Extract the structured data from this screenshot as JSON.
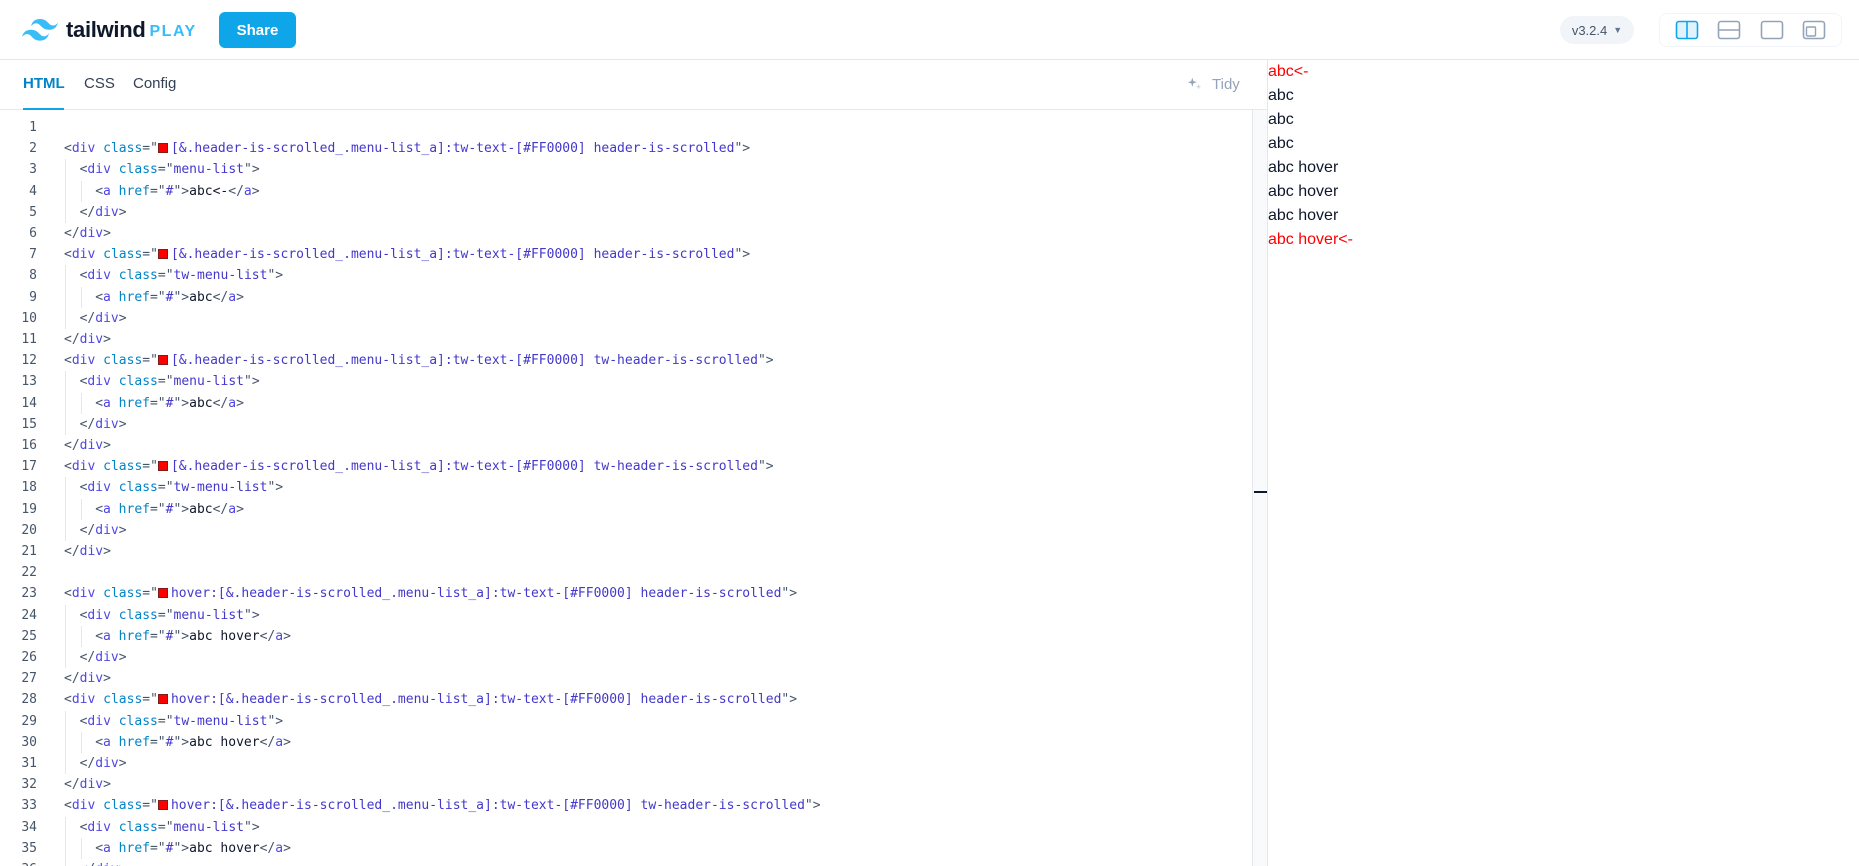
{
  "header": {
    "logo_word": "tailwind",
    "logo_play": "PLAY",
    "share_label": "Share",
    "version": "v3.2.4",
    "layout_buttons": [
      "split-vertical-icon",
      "split-horizontal-icon",
      "editor-only-icon",
      "preview-only-icon"
    ],
    "active_layout": "split-vertical-icon"
  },
  "tabs": {
    "items": [
      "HTML",
      "CSS",
      "Config"
    ],
    "active": "HTML",
    "tidy_label": "Tidy"
  },
  "editor": {
    "lines": [
      "",
      "<div class=\"[&.header-is-scrolled_.menu-list_a]:tw-text-[#FF0000] header-is-scrolled\">",
      "  <div class=\"menu-list\">",
      "    <a href=\"#\">abc<-</a>",
      "  </div>",
      "</div>",
      "<div class=\"[&.header-is-scrolled_.menu-list_a]:tw-text-[#FF0000] header-is-scrolled\">",
      "  <div class=\"tw-menu-list\">",
      "    <a href=\"#\">abc</a>",
      "  </div>",
      "</div>",
      "<div class=\"[&.header-is-scrolled_.menu-list_a]:tw-text-[#FF0000] tw-header-is-scrolled\">",
      "  <div class=\"menu-list\">",
      "    <a href=\"#\">abc</a>",
      "  </div>",
      "</div>",
      "<div class=\"[&.header-is-scrolled_.menu-list_a]:tw-text-[#FF0000] tw-header-is-scrolled\">",
      "  <div class=\"tw-menu-list\">",
      "    <a href=\"#\">abc</a>",
      "  </div>",
      "</div>",
      "",
      "<div class=\"hover:[&.header-is-scrolled_.menu-list_a]:tw-text-[#FF0000] header-is-scrolled\">",
      "  <div class=\"menu-list\">",
      "    <a href=\"#\">abc hover</a>",
      "  </div>",
      "</div>",
      "<div class=\"hover:[&.header-is-scrolled_.menu-list_a]:tw-text-[#FF0000] header-is-scrolled\">",
      "  <div class=\"tw-menu-list\">",
      "    <a href=\"#\">abc hover</a>",
      "  </div>",
      "</div>",
      "<div class=\"hover:[&.header-is-scrolled_.menu-list_a]:tw-text-[#FF0000] tw-header-is-scrolled\">",
      "  <div class=\"menu-list\">",
      "    <a href=\"#\">abc hover</a>",
      "  </div>"
    ]
  },
  "preview": {
    "items": [
      {
        "text": "abc<-",
        "red": true
      },
      {
        "text": "abc",
        "red": false
      },
      {
        "text": "abc",
        "red": false
      },
      {
        "text": "abc",
        "red": false
      },
      {
        "text": "abc hover",
        "red": false
      },
      {
        "text": "abc hover",
        "red": false
      },
      {
        "text": "abc hover",
        "red": false
      },
      {
        "text": "abc hover<-",
        "red": true
      }
    ]
  },
  "colors": {
    "brand": "#38bdf8",
    "share": "#0ea5e9",
    "active_tab": "#0284c7",
    "highlight_red": "#FF0000"
  }
}
